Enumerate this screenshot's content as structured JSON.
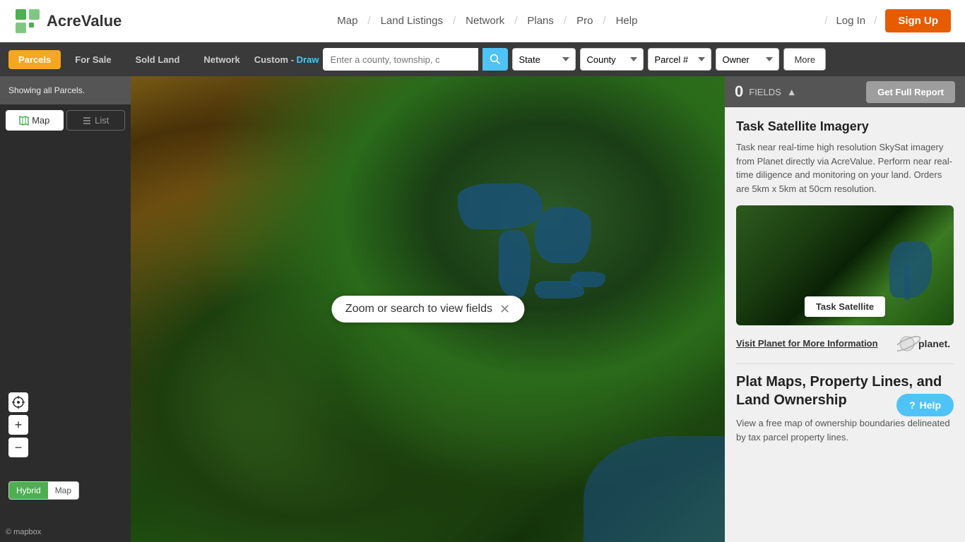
{
  "header": {
    "logo_text": "AcreValue",
    "nav_items": [
      {
        "label": "Map",
        "sep": true
      },
      {
        "label": "Land Listings",
        "sep": true
      },
      {
        "label": "Network",
        "sep": true
      },
      {
        "label": "Plans",
        "sep": true
      },
      {
        "label": "Pro",
        "sep": true
      },
      {
        "label": "Help",
        "sep": false
      }
    ],
    "login_label": "Log In",
    "signup_label": "Sign Up"
  },
  "filter_bar": {
    "tabs": [
      {
        "label": "Parcels",
        "active": true
      },
      {
        "label": "For Sale",
        "active": false
      },
      {
        "label": "Sold Land",
        "active": false
      },
      {
        "label": "Network",
        "active": false
      }
    ],
    "custom_label": "Custom -",
    "draw_label": "Draw",
    "search_placeholder": "Enter a county, township, c",
    "state_label": "State",
    "county_label": "County",
    "parcel_label": "Parcel #",
    "owner_label": "Owner",
    "more_label": "More"
  },
  "status_bar": {
    "text": "Showing all Parcels."
  },
  "view_toggle": {
    "map_label": "Map",
    "list_label": "List"
  },
  "map": {
    "zoom_tooltip": "Zoom or search to view fields",
    "map_type_hybrid": "Hybrid",
    "map_type_map": "Map",
    "mapbox_credit": "© mapbox"
  },
  "fields_bar": {
    "count": "0",
    "label": "FIELDS",
    "report_label": "Get Full Report"
  },
  "panel": {
    "satellite_title": "Task Satellite Imagery",
    "satellite_desc": "Task near real-time high resolution SkySat imagery from Planet directly via AcreValue. Perform near real-time diligence and monitoring on your land. Orders are 5km x 5km at 50cm resolution.",
    "task_satellite_btn": "Task Satellite",
    "visit_planet_label": "Visit Planet for More Information",
    "planet_logo_text": "planet.",
    "ownership_title": "Plat Maps, Property Lines, and Land Ownership",
    "help_btn_label": "Help",
    "ownership_desc": "View a free map of ownership boundaries delineated by tax parcel property lines."
  },
  "icons": {
    "map_icon": "🗺",
    "list_icon": "≡",
    "search_icon": "🔍",
    "locate_icon": "◎",
    "help_icon": "?"
  }
}
